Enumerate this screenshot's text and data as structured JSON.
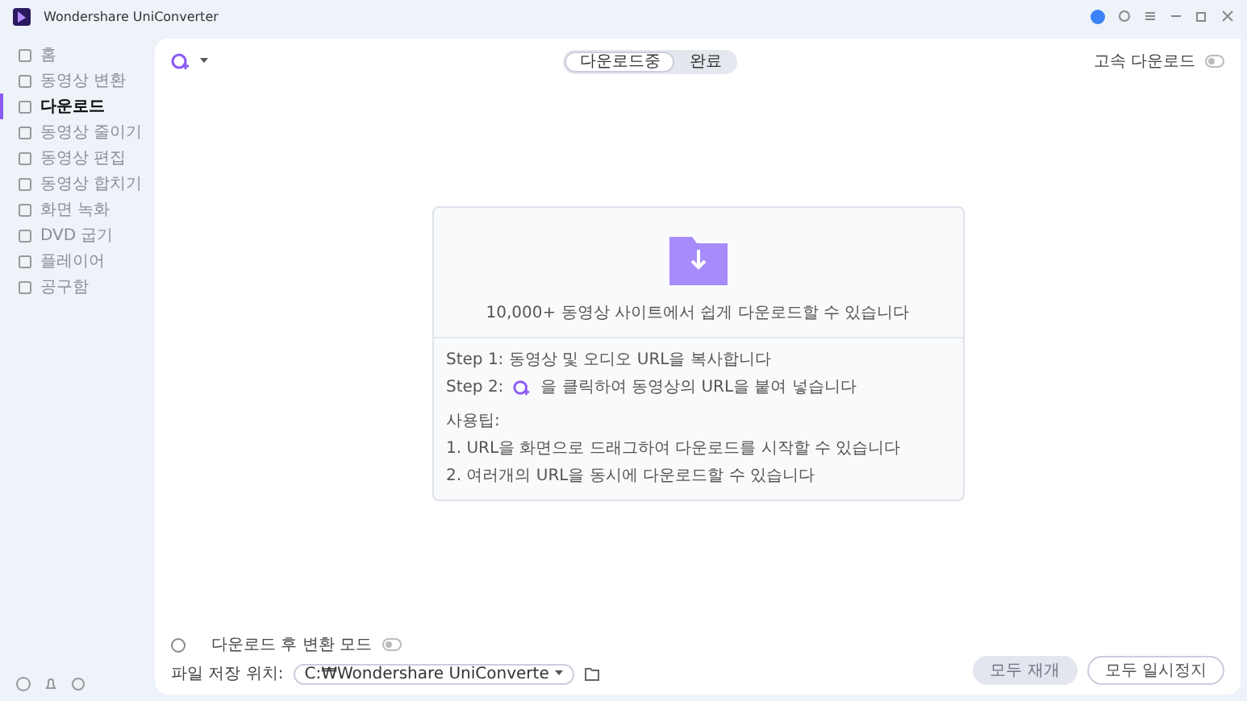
{
  "window": {
    "title": "Wondershare UniConverter"
  },
  "sidebar": {
    "items": [
      {
        "label": "홈",
        "selected": false
      },
      {
        "label": "동영상 변환",
        "selected": false
      },
      {
        "label": "다운로드",
        "selected": true
      },
      {
        "label": "동영상 줄이기",
        "selected": false
      },
      {
        "label": "동영상 편집",
        "selected": false
      },
      {
        "label": "동영상 합치기",
        "selected": false
      },
      {
        "label": "화면 녹화",
        "selected": false
      },
      {
        "label": "DVD 굽기",
        "selected": false
      },
      {
        "label": "플레이어",
        "selected": false
      },
      {
        "label": "공구함",
        "selected": false
      }
    ]
  },
  "tabs": [
    {
      "label": "다운로드중",
      "selected": true
    },
    {
      "label": "완료",
      "selected": false
    }
  ],
  "fast_download": {
    "label": "고속 다운로드",
    "on": false
  },
  "drop_area": {
    "headline": "10,000+ 동영상 사이트에서 쉽게 다운로드할 수 있습니다",
    "step1": "Step 1: 동영상 및 오디오 URL을 복사합니다",
    "step2_prefix": "Step 2:",
    "step2_suffix": "을 클릭하여 동영상의 URL을 붙여 넣습니다",
    "tips_title": "사용팁:",
    "tips": [
      "1. URL을 화면으로 드래그하여 다운로드를 시작할 수 있습니다",
      "2. 여러개의 URL을 동시에 다운로드할 수 있습니다"
    ]
  },
  "convert_mode": {
    "label": "다운로드 후 변환 모드",
    "on": false
  },
  "save_location": {
    "label": "파일 저장 위치:",
    "value": "C:₩Wondershare UniConverte"
  },
  "buttons": [
    {
      "label": "모두 재개",
      "disabled": true
    },
    {
      "label": "모두 일시정지",
      "disabled": false
    }
  ]
}
